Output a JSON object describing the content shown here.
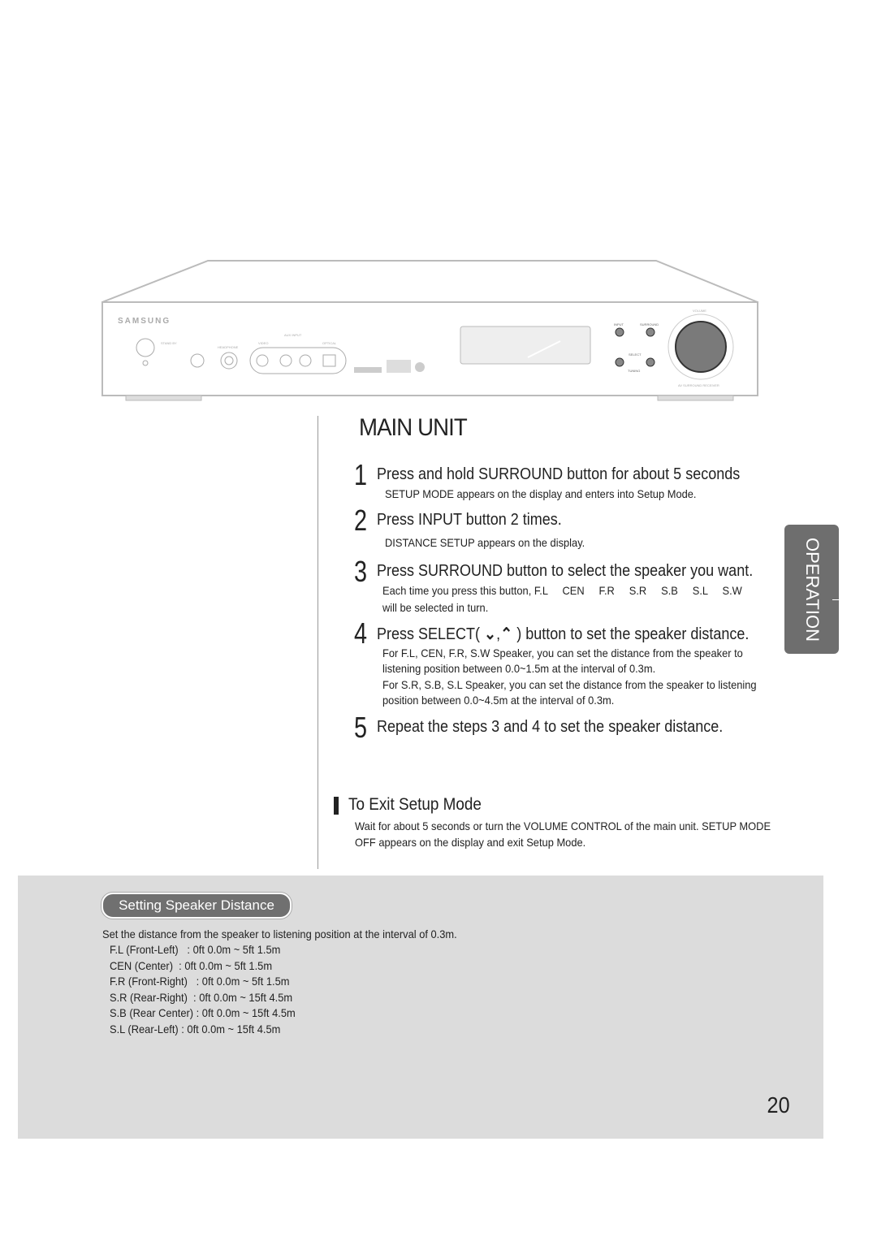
{
  "device": {
    "brand": "SAMSUNG",
    "labels": {
      "standby": "STAND BY",
      "headphone": "HEADPHONE",
      "aux_input": "AUX INPUT",
      "video": "VIDEO",
      "l": "L",
      "aux": "AUX",
      "r": "R",
      "optical": "OPTICAL",
      "input": "INPUT",
      "surround": "SURROUND",
      "select": "SELECT",
      "tuning": "TUNING",
      "volume": "VOLUME",
      "model": "AV SURROUND RECEIVER"
    }
  },
  "title": "MAIN UNIT",
  "steps": [
    {
      "num": "1",
      "heading": "Press and hold SURROUND button for about 5 seconds",
      "lines": [
        "SETUP MODE  appears on the display and enters into Setup Mode."
      ]
    },
    {
      "num": "2",
      "heading": "Press INPUT button 2 times.",
      "lines": [
        "DISTANCE SETUP  appears on the display."
      ]
    },
    {
      "num": "3",
      "heading": "Press SURROUND button to select the speaker you want.",
      "lines": [
        "Each time you press this button, F.L     CEN     F.R     S.R     S.B     S.L     S.W",
        "will be selected in turn."
      ]
    },
    {
      "num": "4",
      "heading_pre": "Press SELECT(",
      "heading_post": ") button to set the speaker distance.",
      "lines": [
        "For F.L, CEN, F.R, S.W Speaker, you can set the distance from the speaker to",
        "listening position between 0.0~1.5m at the interval of 0.3m.",
        "For S.R, S.B, S.L Speaker, you can set the distance from the speaker to listening",
        "position between 0.0~4.5m at the interval of 0.3m."
      ]
    },
    {
      "num": "5",
      "heading": "Repeat the steps 3 and 4 to set the speaker distance.",
      "lines": []
    }
  ],
  "exit": {
    "heading": "To Exit Setup Mode",
    "lines": [
      "Wait for about 5 seconds or turn the VOLUME CONTROL of the main unit.  SETUP MODE",
      "OFF  appears on the display and exit Setup Mode."
    ]
  },
  "side_tab": "OPERATION",
  "note": {
    "title": "Setting Speaker Distance",
    "intro": "Set the distance from the speaker to listening position at the interval of 0.3m.",
    "items": [
      "F.L (Front-Left)   : 0ft 0.0m ~ 5ft 1.5m",
      "CEN (Center)  : 0ft 0.0m ~ 5ft 1.5m",
      "F.R (Front-Right)   : 0ft 0.0m ~ 5ft 1.5m",
      "S.R (Rear-Right)  : 0ft 0.0m ~ 15ft 4.5m",
      "S.B (Rear Center) : 0ft 0.0m ~ 15ft 4.5m",
      "S.L (Rear-Left) : 0ft 0.0m ~ 15ft 4.5m"
    ]
  },
  "page_number": "20"
}
